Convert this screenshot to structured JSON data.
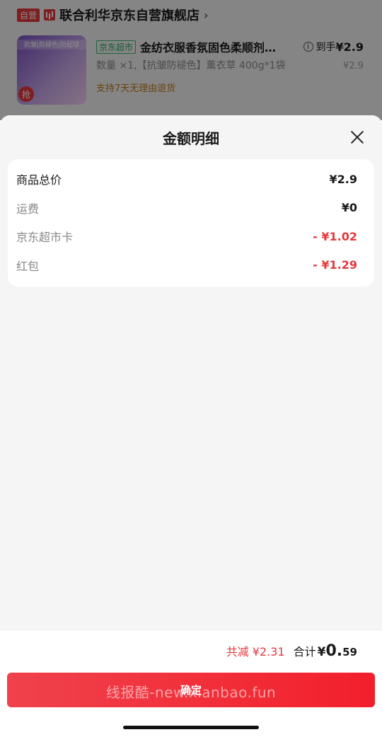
{
  "background_order": {
    "self_operated_badge": "自营",
    "store_name": "联合利华京东自营旗舰店",
    "chevron": "›",
    "product": {
      "image_strip_text": "抗皱|防褪色|防起球",
      "image_tag": "抢",
      "mart_badge": "京东超市",
      "title": "金纺衣服香氛固色柔顺剂…",
      "spec": "数量 ×1,【抗皱防褪色】薰衣草 400g*1袋",
      "return_policy": "支持7天无理由退货",
      "hand_price_label": "到手",
      "hand_price": "¥2.9",
      "original_price": "¥2.9"
    }
  },
  "sheet": {
    "title": "金额明细",
    "rows": [
      {
        "label": "商品总价",
        "value": "¥2.9"
      },
      {
        "label": "运费",
        "value": "¥0"
      },
      {
        "label": "京东超市卡",
        "value": "- ¥1.02"
      },
      {
        "label": "红包",
        "value": "- ¥1.29"
      }
    ]
  },
  "footer": {
    "total_reduction": "共减 ¥2.31",
    "total_label": "合计",
    "total_currency": "¥",
    "total_integer": "0.",
    "total_decimal": "59",
    "confirm_label": "确定",
    "watermark": "线报酷-new.xianbao.fun"
  },
  "colors": {
    "accent_red": "#e4393c",
    "mart_green": "#2aa35c",
    "sheet_bg": "#f5f5f5"
  }
}
